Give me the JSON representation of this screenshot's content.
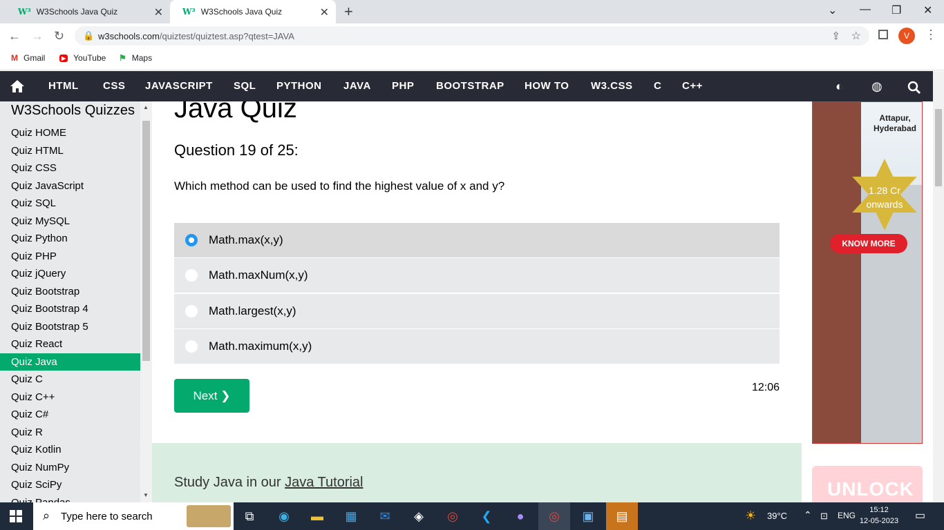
{
  "browser": {
    "tabs": [
      {
        "label": "W3Schools Java Quiz",
        "favicon": "W³"
      },
      {
        "label": "W3Schools Java Quiz",
        "favicon": "W³"
      }
    ],
    "url_domain": "w3schools.com",
    "url_path": "/quiztest/quiztest.asp?qtest=JAVA",
    "profile_initial": "V",
    "bookmarks": [
      {
        "label": "Gmail",
        "icon": "gmail-icon"
      },
      {
        "label": "YouTube",
        "icon": "youtube-icon"
      },
      {
        "label": "Maps",
        "icon": "maps-icon"
      }
    ]
  },
  "topnav": {
    "items": [
      "HTML",
      "CSS",
      "JAVASCRIPT",
      "SQL",
      "PYTHON",
      "JAVA",
      "PHP",
      "BOOTSTRAP",
      "HOW TO",
      "W3.CSS",
      "C",
      "C++"
    ]
  },
  "sidebar": {
    "title": "W3Schools Quizzes",
    "items": [
      "Quiz HOME",
      "Quiz HTML",
      "Quiz CSS",
      "Quiz JavaScript",
      "Quiz SQL",
      "Quiz MySQL",
      "Quiz Python",
      "Quiz PHP",
      "Quiz jQuery",
      "Quiz Bootstrap",
      "Quiz Bootstrap 4",
      "Quiz Bootstrap 5",
      "Quiz React",
      "Quiz Java",
      "Quiz C",
      "Quiz C++",
      "Quiz C#",
      "Quiz R",
      "Quiz Kotlin",
      "Quiz NumPy",
      "Quiz SciPy",
      "Quiz Pandas"
    ],
    "active_item": "Quiz Java"
  },
  "quiz": {
    "title": "Java Quiz",
    "question_number": "Question 19 of 25:",
    "question": "Which method can be used to find the highest value of x and y?",
    "options": [
      "Math.max(x,y)",
      "Math.maxNum(x,y)",
      "Math.largest(x,y)",
      "Math.maximum(x,y)"
    ],
    "selected_option": "Math.max(x,y)",
    "next_label": "Next ❯",
    "timer": "12:06"
  },
  "study": {
    "text": "Study Java in our ",
    "link": "Java Tutorial"
  },
  "ad": {
    "location": [
      "Attapur,",
      "Hyderabad"
    ],
    "price_line1": "1.28 Cr",
    "price_line2": "onwards",
    "button": "KNOW MORE",
    "banner2": "UNLOCK"
  },
  "taskbar": {
    "search_placeholder": "Type here to search",
    "weather": "39°C",
    "language": "ENG",
    "time": "15:12",
    "date": "12-05-2023"
  },
  "colors": {
    "accent": "#04aa6d",
    "nav_bg": "#282a35",
    "radio": "#2196f3"
  }
}
